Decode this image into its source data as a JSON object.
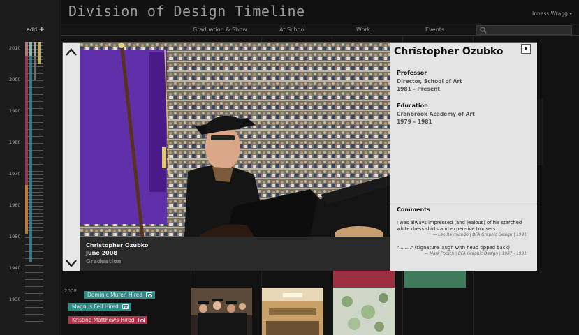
{
  "app": {
    "title": "Division of Design Timeline",
    "user": "Inness Wragg ▾"
  },
  "nav": {
    "items": [
      "Graduation & Show",
      "At School",
      "Work",
      "Events"
    ],
    "search_placeholder": ""
  },
  "sidebar": {
    "add_label": "add",
    "add_icon": "plus-icon",
    "years": [
      "2010",
      "2000",
      "1990",
      "1980",
      "1970",
      "1960",
      "1950",
      "1940",
      "1930"
    ]
  },
  "background": {
    "year_label": "2008",
    "event_tags": [
      {
        "label": "Dominic Muren Hired",
        "color": "#2e8b86"
      },
      {
        "label": "Magnus Feil Hired",
        "color": "#2e8b86"
      },
      {
        "label": "Kristine Matthews Hired",
        "color": "#b5314a"
      }
    ]
  },
  "modal": {
    "caption": {
      "name": "Christopher Ozubko",
      "date": "June 2008",
      "category": "Graduation"
    },
    "info": {
      "name": "Christopher Ozubko",
      "close_label": "x",
      "role_heading": "Professor",
      "role_title": "Director, School of Art",
      "role_dates": "1981 - Present",
      "education_heading": "Education",
      "education_school": "Cranbrook Academy of Art",
      "education_dates": "1979 – 1981",
      "comments_heading": "Comments",
      "comments": [
        {
          "text": "I was always impressed (and jealous) of his starched white dress shirts and expensive trousers",
          "attribution": "— Leo Raymundo  |  BFA Graphic Design  |  1991"
        },
        {
          "text": "\"........\"  (signature laugh with head tipped back)",
          "attribution": "— Mark Popich  |  BFA Graphic Design  |  1987 - 1991"
        }
      ]
    }
  },
  "colors": {
    "accent_teal": "#2e8b86",
    "accent_red": "#b5314a",
    "purple_banner": "#5a2aa0"
  }
}
